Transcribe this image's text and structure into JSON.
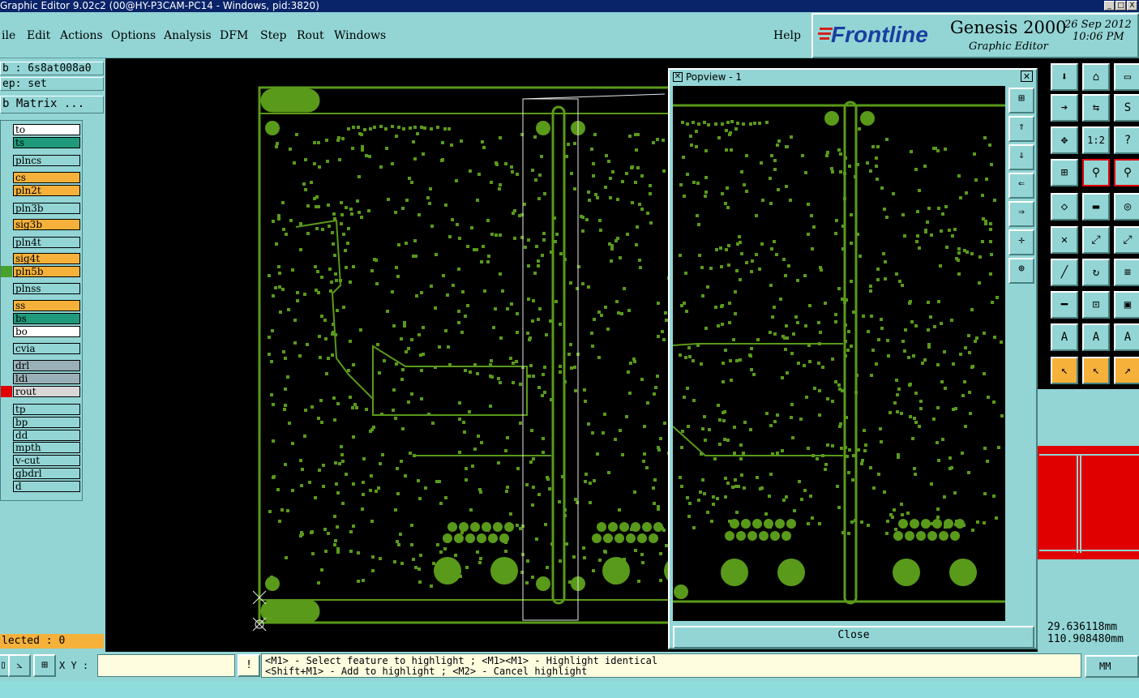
{
  "window": {
    "title": "Graphic Editor 9.02c2 (00@HY-P3CAM-PC14 - Windows, pid:3820)",
    "buttons": [
      "_",
      "□",
      "X"
    ]
  },
  "menu": {
    "items": [
      "ile",
      "Edit",
      "Actions",
      "Options",
      "Analysis",
      "DFM",
      "Step",
      "Rout",
      "Windows"
    ],
    "help": "Help"
  },
  "brand": {
    "logo": "Frontline",
    "product": "Genesis 2000",
    "subtitle": "Graphic Editor",
    "date": "26 Sep 2012",
    "time": "10:06 PM"
  },
  "info": {
    "job": "b : 6s8at008a0",
    "step": "ep: set",
    "matrix_button": "b Matrix ..."
  },
  "layers": [
    {
      "name": "to",
      "color": "#ffffff",
      "mark": "#93d5d5"
    },
    {
      "name": "ts",
      "color": "#1f9a7a",
      "mark": "#93d5d5"
    },
    {
      "name": "plncs",
      "color": "#93d5d5",
      "mark": "#93d5d5"
    },
    {
      "name": "cs",
      "color": "#f5b13a",
      "mark": "#93d5d5"
    },
    {
      "name": "pln2t",
      "color": "#f5b13a",
      "mark": "#93d5d5"
    },
    {
      "name": "pln3b",
      "color": "#93d5d5",
      "mark": "#93d5d5"
    },
    {
      "name": "sig3b",
      "color": "#f5b13a",
      "mark": "#93d5d5"
    },
    {
      "name": "pln4t",
      "color": "#93d5d5",
      "mark": "#93d5d5"
    },
    {
      "name": "sig4t",
      "color": "#f5b13a",
      "mark": "#93d5d5"
    },
    {
      "name": "pln5b",
      "color": "#f5b13a",
      "mark": "#4aa02c"
    },
    {
      "name": "plnss",
      "color": "#93d5d5",
      "mark": "#93d5d5"
    },
    {
      "name": "ss",
      "color": "#f5b13a",
      "mark": "#93d5d5"
    },
    {
      "name": "bs",
      "color": "#1f9a7a",
      "mark": "#93d5d5"
    },
    {
      "name": "bo",
      "color": "#ffffff",
      "mark": "#93d5d5"
    },
    {
      "name": "cvia",
      "color": "#93d5d5",
      "mark": "#93d5d5"
    },
    {
      "name": "drl",
      "color": "#9ab0b8",
      "mark": "#93d5d5"
    },
    {
      "name": "ldi",
      "color": "#9ab0b8",
      "mark": "#93d5d5"
    },
    {
      "name": "rout",
      "color": "#d8d8d8",
      "mark": "#e00000"
    },
    {
      "name": "tp",
      "color": "#93d5d5",
      "mark": "#93d5d5"
    },
    {
      "name": "bp",
      "color": "#93d5d5",
      "mark": "#93d5d5"
    },
    {
      "name": "dd",
      "color": "#93d5d5",
      "mark": "#93d5d5"
    },
    {
      "name": "mpth",
      "color": "#93d5d5",
      "mark": "#93d5d5"
    },
    {
      "name": "v-cut",
      "color": "#93d5d5",
      "mark": "#93d5d5"
    },
    {
      "name": "gbdrl",
      "color": "#93d5d5",
      "mark": "#93d5d5"
    },
    {
      "name": "d",
      "color": "#93d5d5",
      "mark": "#93d5d5"
    }
  ],
  "selected": "lected : 0",
  "popview": {
    "title": "Popview - 1",
    "close_label": "Close"
  },
  "coords": {
    "x": "29.636118mm",
    "y": "110.908480mm"
  },
  "statusbar": {
    "xy_label": "X Y :",
    "xy_value": "",
    "prompt_line1": "<M1> - Select feature to highlight ; <M1><M1> - Highlight identical",
    "prompt_line2": "<Shift+M1> - Add to highlight ; <M2> - Cancel highlight",
    "units": "MM"
  },
  "colors": {
    "pcb_green": "#5a9a1a",
    "background": "#93d5d5"
  },
  "icons": [
    "pin-icon",
    "home-icon",
    "window-icon",
    "import-icon",
    "step-icon",
    "fit-icon",
    "ratio-icon",
    "help-icon"
  ]
}
